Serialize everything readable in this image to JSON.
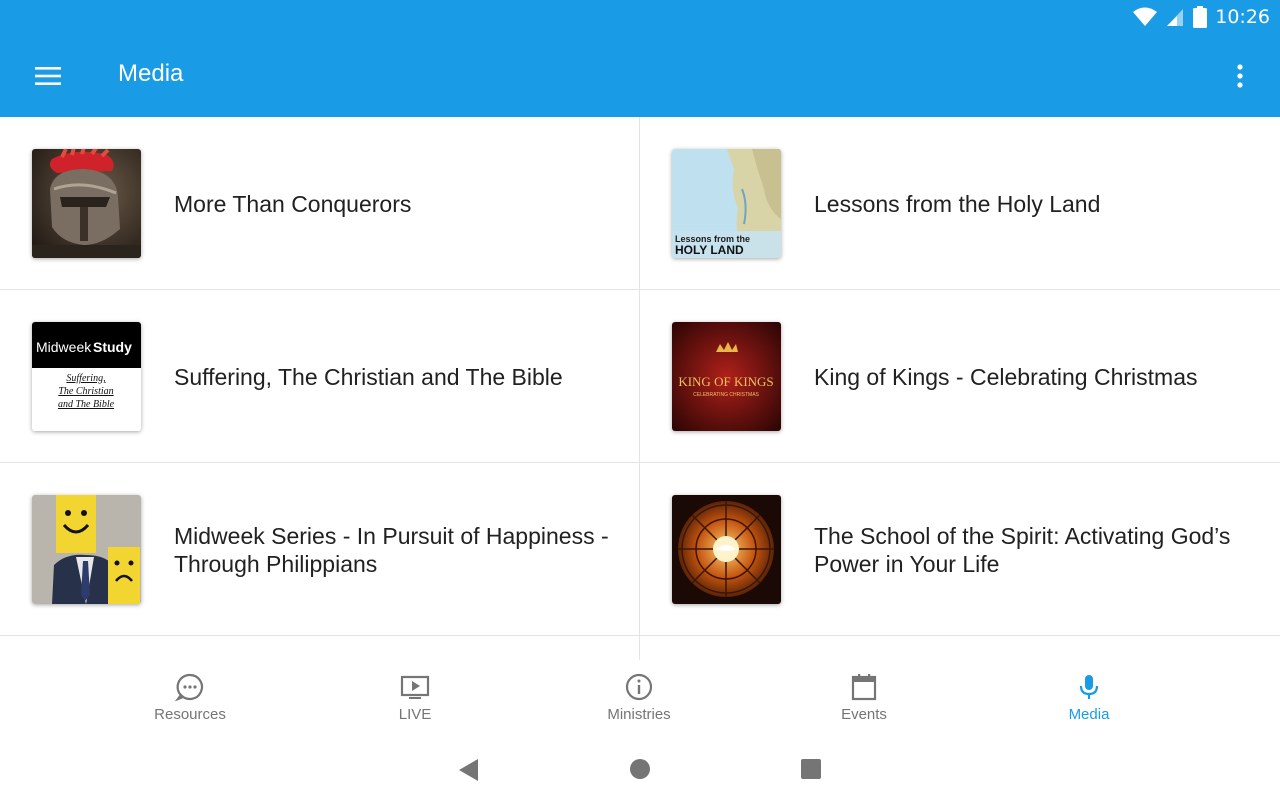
{
  "status": {
    "time": "10:26"
  },
  "appbar": {
    "title": "Media"
  },
  "items": [
    {
      "title": "More Than Conquerors",
      "thumb": "helmet-thumbnail"
    },
    {
      "title": "Lessons from the Holy Land",
      "thumb": "holy-land-map-thumbnail",
      "thumb_text": {
        "line1": "Lessons from the",
        "line2": "HOLY LAND"
      }
    },
    {
      "title": "Suffering, The Christian and The Bible",
      "thumb": "midweek-study-thumbnail",
      "thumb_text": {
        "header_a": "Midweek",
        "header_b": "Study",
        "line1": "Suffering,",
        "line2": "The Christian",
        "line3": "and The Bible"
      }
    },
    {
      "title": "King of Kings - Celebrating Christmas",
      "thumb": "king-of-kings-thumbnail",
      "thumb_text": {
        "main": "KING OF KINGS",
        "sub": "CELEBRATING CHRISTMAS"
      }
    },
    {
      "title": "Midweek Series - In Pursuit of Happiness - Through Philippians",
      "thumb": "smiley-mask-thumbnail"
    },
    {
      "title": "The School of the Spirit: Activating God’s Power in Your Life",
      "thumb": "stained-glass-dove-thumbnail"
    }
  ],
  "bottom_nav": [
    {
      "label": "Resources",
      "icon": "chat-bubble-icon",
      "active": false
    },
    {
      "label": "LIVE",
      "icon": "tv-play-icon",
      "active": false
    },
    {
      "label": "Ministries",
      "icon": "info-circle-icon",
      "active": false
    },
    {
      "label": "Events",
      "icon": "calendar-icon",
      "active": false
    },
    {
      "label": "Media",
      "icon": "microphone-icon",
      "active": true
    }
  ],
  "colors": {
    "primary": "#1a9be6",
    "inactive": "#757575",
    "text": "#212121"
  }
}
